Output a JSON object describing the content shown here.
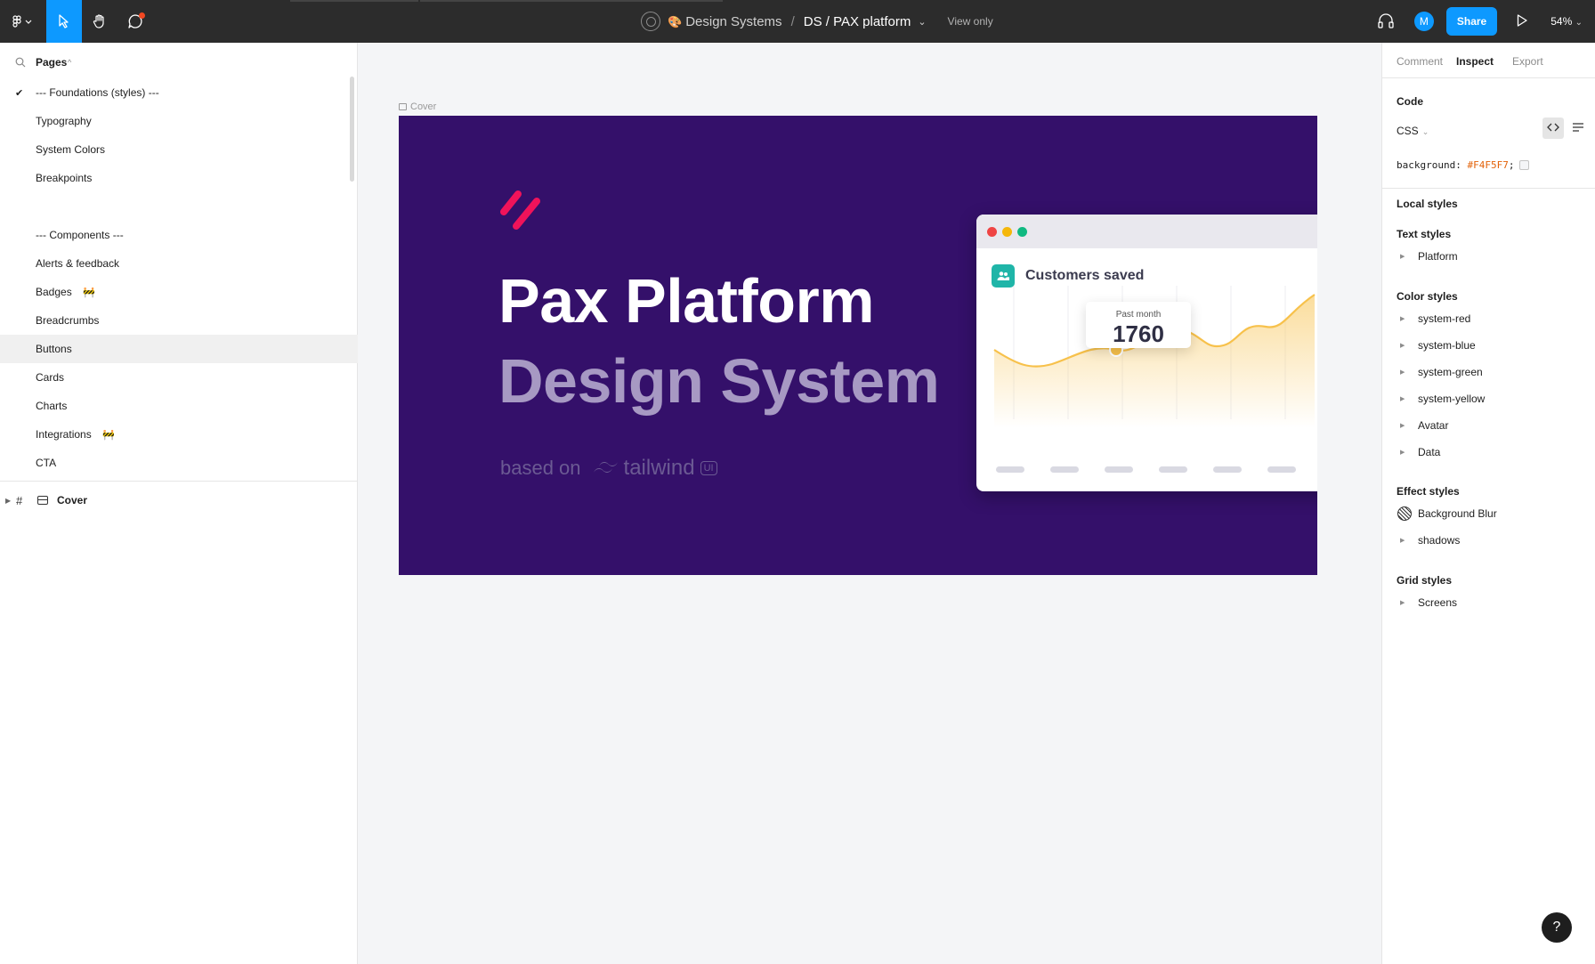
{
  "toolbar": {
    "team": "Design Systems",
    "separator": "/",
    "file_name": "DS / PAX platform",
    "view_only": "View only",
    "avatar_initial": "M",
    "share_label": "Share",
    "zoom": "54%"
  },
  "pages_panel": {
    "title": "Pages",
    "pages": [
      {
        "label": "--- Foundations (styles) ---",
        "checked": true
      },
      {
        "label": "Typography"
      },
      {
        "label": "System Colors"
      },
      {
        "label": "Breakpoints"
      },
      {
        "label": ""
      },
      {
        "label": "--- Components ---"
      },
      {
        "label": "Alerts & feedback"
      },
      {
        "label": "Badges",
        "badge": "🚧"
      },
      {
        "label": "Breadcrumbs"
      },
      {
        "label": "Buttons",
        "active": true
      },
      {
        "label": "Cards"
      },
      {
        "label": "Charts"
      },
      {
        "label": "Integrations",
        "badge": "🚧"
      },
      {
        "label": "CTA"
      }
    ],
    "layer": {
      "label": "Cover"
    }
  },
  "canvas": {
    "frame_label": "Cover",
    "cover": {
      "title": "Pax Platform",
      "subtitle": "Design System",
      "based_on": "based on",
      "tailwind": "tailwind",
      "ui_badge": "UI",
      "card": {
        "title": "Customers saved",
        "tooltip_label": "Past month",
        "tooltip_value": "1760"
      }
    }
  },
  "inspect_panel": {
    "tabs": [
      "Comment",
      "Inspect",
      "Export"
    ],
    "active_tab": "Inspect",
    "code_title": "Code",
    "language": "CSS",
    "css_property": "background:",
    "css_value": "#F4F5F7",
    "css_end": ";",
    "local_styles": "Local styles",
    "text_styles_title": "Text styles",
    "text_styles": [
      "Platform"
    ],
    "color_styles_title": "Color styles",
    "color_styles": [
      "system-red",
      "system-blue",
      "system-green",
      "system-yellow",
      "Avatar",
      "Data"
    ],
    "effect_styles_title": "Effect styles",
    "effect_styles": [
      "Background Blur",
      "shadows"
    ],
    "grid_styles_title": "Grid styles",
    "grid_styles": [
      "Screens"
    ]
  },
  "colors": {
    "toolbar_bg": "#2C2C2C",
    "accent": "#0D99FF",
    "cover_bg": "#34106A",
    "subtitle": "#A799C3",
    "logo_pink": "#F0135A",
    "chart_line": "#F7C14B"
  },
  "help": "?"
}
